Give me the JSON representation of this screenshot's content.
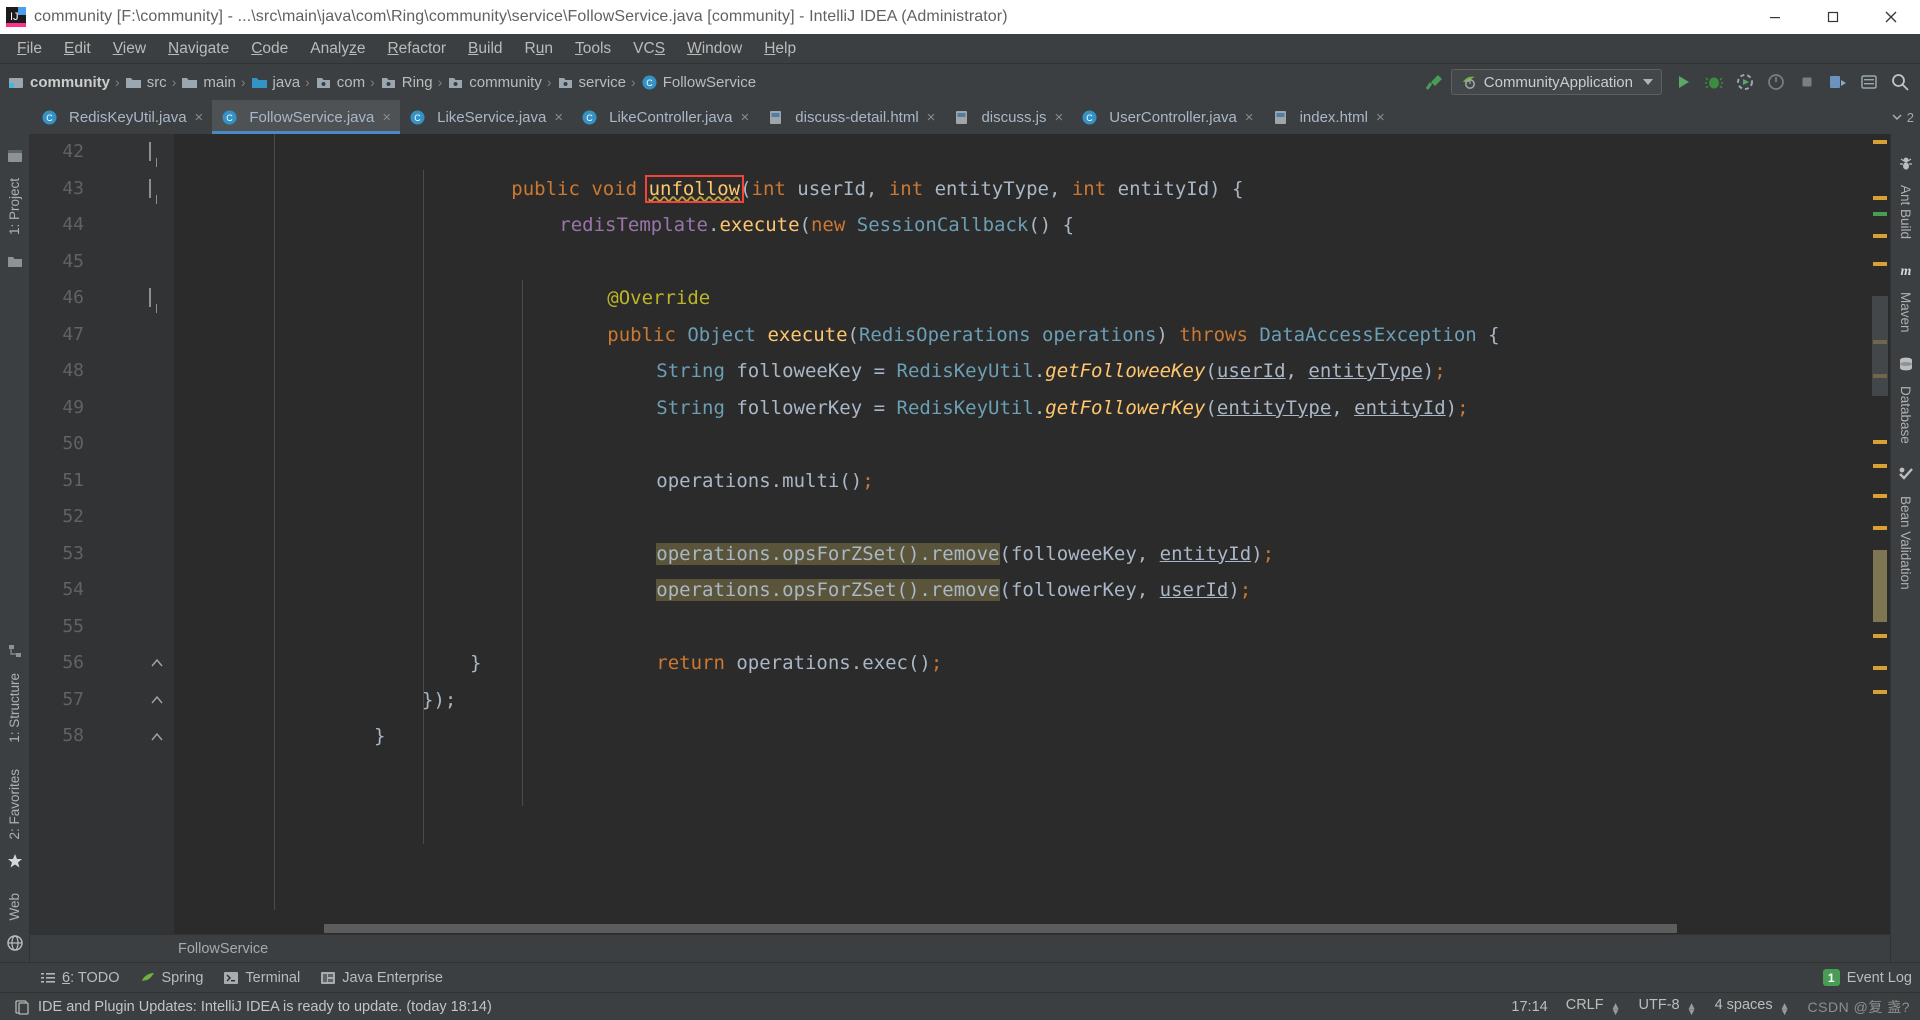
{
  "window": {
    "title": "community [F:\\community] - ...\\src\\main\\java\\com\\Ring\\community\\service\\FollowService.java [community] - IntelliJ IDEA (Administrator)",
    "app_icon": "intellij-idea-icon",
    "controls": {
      "minimize": "minimize-icon",
      "maximize": "maximize-icon",
      "close": "close-icon"
    }
  },
  "menubar": {
    "items": [
      {
        "label": "File",
        "mnemonic": "F"
      },
      {
        "label": "Edit",
        "mnemonic": "E"
      },
      {
        "label": "View",
        "mnemonic": "V"
      },
      {
        "label": "Navigate",
        "mnemonic": "N"
      },
      {
        "label": "Code",
        "mnemonic": "C"
      },
      {
        "label": "Analyze",
        "mnemonic": "z"
      },
      {
        "label": "Refactor",
        "mnemonic": "R"
      },
      {
        "label": "Build",
        "mnemonic": "B"
      },
      {
        "label": "Run",
        "mnemonic": "u"
      },
      {
        "label": "Tools",
        "mnemonic": "T"
      },
      {
        "label": "VCS",
        "mnemonic": "S"
      },
      {
        "label": "Window",
        "mnemonic": "W"
      },
      {
        "label": "Help",
        "mnemonic": "H"
      }
    ]
  },
  "navbar": {
    "crumbs": [
      {
        "label": "community",
        "icon": "module-icon",
        "bold": true
      },
      {
        "label": "src",
        "icon": "folder-icon",
        "bold": false
      },
      {
        "label": "main",
        "icon": "folder-icon",
        "bold": false
      },
      {
        "label": "java",
        "icon": "source-root-icon",
        "bold": false
      },
      {
        "label": "com",
        "icon": "package-icon",
        "bold": false
      },
      {
        "label": "Ring",
        "icon": "package-icon",
        "bold": false
      },
      {
        "label": "community",
        "icon": "package-icon",
        "bold": false
      },
      {
        "label": "service",
        "icon": "package-icon",
        "bold": false
      },
      {
        "label": "FollowService",
        "icon": "class-icon",
        "bold": false
      }
    ],
    "separator": "›",
    "run_config": {
      "label": "CommunityApplication",
      "icon": "spring-boot-icon"
    },
    "buttons": [
      {
        "name": "build-hammer-icon",
        "title": "Build"
      },
      {
        "name": "run-icon",
        "title": "Run"
      },
      {
        "name": "debug-icon",
        "title": "Debug"
      },
      {
        "name": "run-with-coverage-icon",
        "title": "Run with Coverage"
      },
      {
        "name": "profile-icon",
        "title": "Profile"
      },
      {
        "name": "stop-icon",
        "title": "Stop"
      },
      {
        "name": "update-app-icon",
        "title": "Update application"
      },
      {
        "name": "settings-icon",
        "title": "Settings"
      },
      {
        "name": "search-everywhere-icon",
        "title": "Search Everywhere"
      }
    ]
  },
  "tabs": {
    "items": [
      {
        "label": "RedisKeyUtil.java",
        "icon": "java-class-icon",
        "active": false
      },
      {
        "label": "FollowService.java",
        "icon": "java-class-icon",
        "active": true
      },
      {
        "label": "LikeService.java",
        "icon": "java-class-icon",
        "active": false
      },
      {
        "label": "LikeController.java",
        "icon": "java-class-icon",
        "active": false
      },
      {
        "label": "discuss-detail.html",
        "icon": "html-file-icon",
        "active": false
      },
      {
        "label": "discuss.js",
        "icon": "js-file-icon",
        "active": false
      },
      {
        "label": "UserController.java",
        "icon": "java-class-icon",
        "active": false
      },
      {
        "label": "index.html",
        "icon": "html-file-icon",
        "active": false
      }
    ],
    "overflow_count": "2",
    "close_glyph": "×"
  },
  "left_strip": {
    "items": [
      {
        "label": "1: Project",
        "icon": "project-icon"
      },
      {
        "label": "1: Structure",
        "icon": "structure-icon"
      },
      {
        "label": "2: Favorites",
        "icon": "favorites-star-icon"
      },
      {
        "label": "Web",
        "icon": "web-icon"
      }
    ]
  },
  "right_strip": {
    "items": [
      {
        "label": "Ant Build",
        "icon": "ant-icon"
      },
      {
        "label": "Maven",
        "icon": "maven-icon"
      },
      {
        "label": "Database",
        "icon": "database-icon"
      },
      {
        "label": "Bean Validation",
        "icon": "bean-validation-icon"
      }
    ]
  },
  "editor": {
    "file": "FollowService.java",
    "first_line": 42,
    "lines": [
      {
        "num": "42",
        "indent": 2,
        "gutter_icon": "method-override-marker",
        "fold": "open",
        "tokens": [
          {
            "t": "public ",
            "c": "kw"
          },
          {
            "t": "void ",
            "c": "kw"
          },
          {
            "t": "unfollow",
            "c": "mth",
            "box": true,
            "squiggle": true
          },
          {
            "t": "(",
            "c": "pn"
          },
          {
            "t": "int ",
            "c": "kw"
          },
          {
            "t": "userId, ",
            "c": "id"
          },
          {
            "t": "int ",
            "c": "kw"
          },
          {
            "t": "entityType, ",
            "c": "id"
          },
          {
            "t": "int ",
            "c": "kw"
          },
          {
            "t": "entityId",
            "c": "id"
          },
          {
            "t": ") {",
            "c": "pn"
          }
        ]
      },
      {
        "num": "43",
        "indent": 3,
        "fold": "open",
        "tokens": [
          {
            "t": "redisTemplate",
            "c": "fld"
          },
          {
            "t": ".",
            "c": "pn"
          },
          {
            "t": "execute",
            "c": "mth"
          },
          {
            "t": "(",
            "c": "pn"
          },
          {
            "t": "new ",
            "c": "kw"
          },
          {
            "t": "SessionCallback",
            "c": "cls"
          },
          {
            "t": "() {",
            "c": "pn"
          }
        ]
      },
      {
        "num": "44",
        "indent": 0,
        "tokens": []
      },
      {
        "num": "45",
        "indent": 4,
        "tokens": [
          {
            "t": "@Override",
            "c": "ann"
          }
        ]
      },
      {
        "num": "46",
        "indent": 4,
        "gutter_icon": "implementing-method-marker",
        "fold": "open",
        "tokens": [
          {
            "t": "public ",
            "c": "kw"
          },
          {
            "t": "Object ",
            "c": "cls"
          },
          {
            "t": "execute",
            "c": "mth"
          },
          {
            "t": "(",
            "c": "pn"
          },
          {
            "t": "RedisOperations operations",
            "c": "cls"
          },
          {
            "t": ") ",
            "c": "pn"
          },
          {
            "t": "throws ",
            "c": "kw"
          },
          {
            "t": "DataAccessException",
            "c": "cls"
          },
          {
            "t": " {",
            "c": "pn"
          }
        ]
      },
      {
        "num": "47",
        "indent": 5,
        "tokens": [
          {
            "t": "String ",
            "c": "cls"
          },
          {
            "t": "followeeKey ",
            "c": "id"
          },
          {
            "t": "= ",
            "c": "pn"
          },
          {
            "t": "RedisKeyUtil",
            "c": "cls"
          },
          {
            "t": ".",
            "c": "pn"
          },
          {
            "t": "getFolloweeKey",
            "c": "mthi"
          },
          {
            "t": "(",
            "c": "pn"
          },
          {
            "t": "userId",
            "c": "par"
          },
          {
            "t": ", ",
            "c": "pn"
          },
          {
            "t": "entityType",
            "c": "par"
          },
          {
            "t": ")",
            "c": "pn"
          },
          {
            "t": ";",
            "c": "semi"
          }
        ]
      },
      {
        "num": "48",
        "indent": 5,
        "tokens": [
          {
            "t": "String ",
            "c": "cls"
          },
          {
            "t": "followerKey ",
            "c": "id"
          },
          {
            "t": "= ",
            "c": "pn"
          },
          {
            "t": "RedisKeyUtil",
            "c": "cls"
          },
          {
            "t": ".",
            "c": "pn"
          },
          {
            "t": "getFollowerKey",
            "c": "mthi"
          },
          {
            "t": "(",
            "c": "pn"
          },
          {
            "t": "entityType",
            "c": "par"
          },
          {
            "t": ", ",
            "c": "pn"
          },
          {
            "t": "entityId",
            "c": "par"
          },
          {
            "t": ")",
            "c": "pn"
          },
          {
            "t": ";",
            "c": "semi"
          }
        ]
      },
      {
        "num": "49",
        "indent": 0,
        "tokens": []
      },
      {
        "num": "50",
        "indent": 5,
        "tokens": [
          {
            "t": "operations",
            "c": "id"
          },
          {
            "t": ".",
            "c": "pn"
          },
          {
            "t": "multi",
            "c": "id"
          },
          {
            "t": "()",
            "c": "pn"
          },
          {
            "t": ";",
            "c": "semi"
          }
        ]
      },
      {
        "num": "51",
        "indent": 0,
        "tokens": []
      },
      {
        "num": "52",
        "indent": 5,
        "highlight": true,
        "tokens": [
          {
            "t": "operations",
            "c": "id"
          },
          {
            "t": ".",
            "c": "pn"
          },
          {
            "t": "opsForZSet",
            "c": "id"
          },
          {
            "t": "()",
            "c": "pn"
          },
          {
            "t": ".",
            "c": "pn"
          },
          {
            "t": "remove",
            "c": "id"
          },
          {
            "t": "(",
            "c": "pn"
          },
          {
            "t": "followeeKey, ",
            "c": "id"
          },
          {
            "t": "entityId",
            "c": "par"
          },
          {
            "t": ")",
            "c": "pn"
          },
          {
            "t": ";",
            "c": "semi"
          }
        ]
      },
      {
        "num": "53",
        "indent": 5,
        "highlight": true,
        "tokens": [
          {
            "t": "operations",
            "c": "id"
          },
          {
            "t": ".",
            "c": "pn"
          },
          {
            "t": "opsForZSet",
            "c": "id"
          },
          {
            "t": "()",
            "c": "pn"
          },
          {
            "t": ".",
            "c": "pn"
          },
          {
            "t": "remove",
            "c": "id"
          },
          {
            "t": "(",
            "c": "pn"
          },
          {
            "t": "followerKey, ",
            "c": "id"
          },
          {
            "t": "userId",
            "c": "par"
          },
          {
            "t": ")",
            "c": "pn"
          },
          {
            "t": ";",
            "c": "semi"
          }
        ]
      },
      {
        "num": "54",
        "indent": 0,
        "tokens": []
      },
      {
        "num": "55",
        "indent": 5,
        "tokens": [
          {
            "t": "return ",
            "c": "kw"
          },
          {
            "t": "operations",
            "c": "id"
          },
          {
            "t": ".",
            "c": "pn"
          },
          {
            "t": "exec",
            "c": "id"
          },
          {
            "t": "()",
            "c": "pn"
          },
          {
            "t": ";",
            "c": "semi"
          }
        ]
      },
      {
        "num": "56",
        "indent": 4,
        "fold": "close",
        "tokens": [
          {
            "t": "}",
            "c": "pn"
          }
        ]
      },
      {
        "num": "57",
        "indent": 3,
        "fold": "close",
        "tokens": [
          {
            "t": "});",
            "c": "pn"
          }
        ]
      },
      {
        "num": "58",
        "indent": 2,
        "fold": "close",
        "tokens": [
          {
            "t": "}",
            "c": "pn"
          }
        ]
      }
    ],
    "breadcrumb": "FollowService"
  },
  "toolwindow_bar": {
    "items": [
      {
        "label": "6: TODO",
        "mnemonic": "6",
        "icon": "todo-icon"
      },
      {
        "label": "Spring",
        "icon": "spring-leaf-icon"
      },
      {
        "label": "Terminal",
        "icon": "terminal-icon"
      },
      {
        "label": "Java Enterprise",
        "icon": "java-enterprise-icon"
      }
    ],
    "event_log": {
      "label": "Event Log",
      "count": "1"
    }
  },
  "statusbar": {
    "message": "IDE and Plugin Updates: IntelliJ IDEA is ready to update. (today 18:14)",
    "message_icon": "notification-icon",
    "position": "17:14",
    "line_separator": "CRLF",
    "encoding": "UTF-8",
    "indent": "4 spaces",
    "watermark": "CSDN @复 盏?"
  },
  "colors": {
    "accent": "#4a88c7",
    "editor_bg": "#2b2b2b",
    "chrome_bg": "#3c3f41",
    "gutter_bg": "#313335",
    "highlight": "#5a553a",
    "error_box": "#f4443a",
    "green": "#499c54"
  }
}
